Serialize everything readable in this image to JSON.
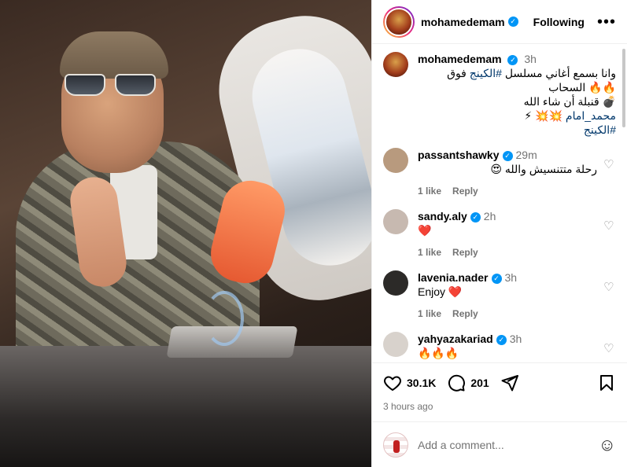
{
  "post": {
    "username": "mohamedemam",
    "follow_label": "Following",
    "more_label": "•••",
    "caption": {
      "username": "mohamedemam",
      "time": "3h",
      "line1": "وانا بسمع أغاني مسلسل",
      "hashtag1": "#الكينج",
      "line1_end": "فوق",
      "line2": "🔥🔥 السحاب",
      "line3": "💣 قنبلة أن شاء الله",
      "line4_link": "محمد_امام",
      "line4_emoji": "💥💥 ⚡",
      "hashtag2": "#الكينج"
    },
    "comments": [
      {
        "username": "passantshawky",
        "time": "29m",
        "text": "رحلة متتنسيش والله 😍",
        "likes": "1 like",
        "reply": "Reply",
        "avatar_color": "#b89a7e"
      },
      {
        "username": "sandy.aly",
        "time": "2h",
        "text": "❤️",
        "likes": "1 like",
        "reply": "Reply",
        "avatar_color": "#c7b9b0"
      },
      {
        "username": "lavenia.nader",
        "time": "3h",
        "text": "Enjoy ❤️",
        "likes": "1 like",
        "reply": "Reply",
        "avatar_color": "#2c2a28"
      },
      {
        "username": "yahyazakariad",
        "time": "3h",
        "text": "🔥🔥🔥",
        "likes": "",
        "reply": "",
        "avatar_color": "#d8d2cc"
      }
    ],
    "likes_count": "30.1K",
    "comments_count": "201",
    "time_ago": "3 hours ago",
    "add_comment_placeholder": "Add a comment...",
    "colors": {
      "accent": "#0095f6",
      "hashtag": "#00376b",
      "muted": "#737373"
    }
  }
}
